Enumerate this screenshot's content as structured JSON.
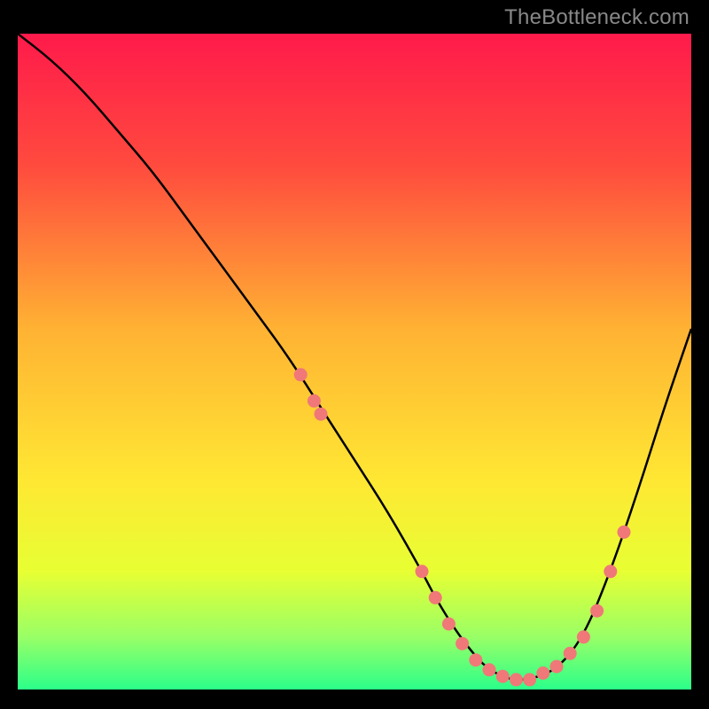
{
  "attribution": "TheBottleneck.com",
  "chart_data": {
    "type": "line",
    "title": "",
    "xlabel": "",
    "ylabel": "",
    "xlim": [
      0,
      100
    ],
    "ylim": [
      0,
      100
    ],
    "gradient_stops": [
      {
        "offset": 0,
        "color": "#ff1a4b"
      },
      {
        "offset": 20,
        "color": "#ff4a3e"
      },
      {
        "offset": 45,
        "color": "#ffb233"
      },
      {
        "offset": 68,
        "color": "#ffe733"
      },
      {
        "offset": 82,
        "color": "#e7ff33"
      },
      {
        "offset": 92,
        "color": "#99ff66"
      },
      {
        "offset": 100,
        "color": "#2bff8a"
      }
    ],
    "series": [
      {
        "name": "bottleneck-curve",
        "x": [
          0,
          5,
          10,
          15,
          20,
          25,
          30,
          35,
          40,
          45,
          50,
          55,
          60,
          62,
          65,
          68,
          70,
          73,
          76,
          80,
          84,
          88,
          92,
          96,
          100
        ],
        "y": [
          100,
          96,
          91,
          85,
          79,
          72,
          65,
          58,
          51,
          43,
          35,
          27,
          18,
          14,
          9,
          5,
          3,
          1.5,
          1.5,
          3,
          8,
          18,
          30,
          43,
          55
        ]
      }
    ],
    "markers": [
      {
        "x": 42,
        "y": 48
      },
      {
        "x": 44,
        "y": 44
      },
      {
        "x": 45,
        "y": 42
      },
      {
        "x": 60,
        "y": 18
      },
      {
        "x": 62,
        "y": 14
      },
      {
        "x": 64,
        "y": 10
      },
      {
        "x": 66,
        "y": 7
      },
      {
        "x": 68,
        "y": 4.5
      },
      {
        "x": 70,
        "y": 3
      },
      {
        "x": 72,
        "y": 2
      },
      {
        "x": 74,
        "y": 1.5
      },
      {
        "x": 76,
        "y": 1.5
      },
      {
        "x": 78,
        "y": 2.5
      },
      {
        "x": 80,
        "y": 3.5
      },
      {
        "x": 82,
        "y": 5.5
      },
      {
        "x": 84,
        "y": 8
      },
      {
        "x": 86,
        "y": 12
      },
      {
        "x": 88,
        "y": 18
      },
      {
        "x": 90,
        "y": 24
      }
    ],
    "marker_color": "#f07878",
    "curve_color": "#000000"
  }
}
